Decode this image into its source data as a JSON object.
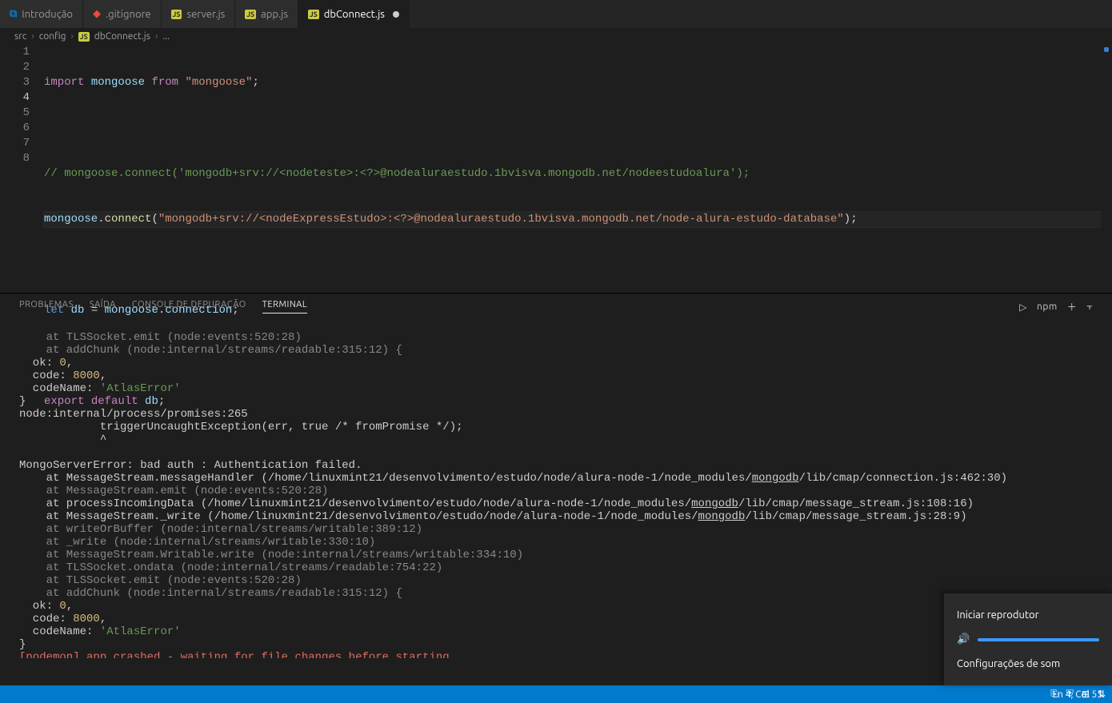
{
  "tabs": [
    {
      "icon": "vs",
      "label": "Introdução"
    },
    {
      "icon": "git",
      "label": ".gitignore"
    },
    {
      "icon": "js",
      "label": "server.js"
    },
    {
      "icon": "js",
      "label": "app.js"
    },
    {
      "icon": "js",
      "label": "dbConnect.js",
      "active": true,
      "modified": true
    }
  ],
  "breadcrumb": {
    "seg1": "src",
    "seg2": "config",
    "seg3": "dbConnect.js",
    "seg4": "..."
  },
  "code": {
    "lines": [
      "1",
      "2",
      "3",
      "4",
      "5",
      "6",
      "7",
      "8"
    ],
    "l1": {
      "import": "import",
      "mongoose": "mongoose",
      "from": "from",
      "str": "\"mongoose\"",
      "semi": ";"
    },
    "l3": {
      "comment": "// mongoose.connect('mongodb+srv://<nodeteste>:<?>@nodealuraestudo.1bvisva.mongodb.net/nodeestudoalura');"
    },
    "l4": {
      "obj": "mongoose",
      "dot": ".",
      "fn": "connect",
      "open": "(",
      "str": "\"mongodb+srv://<nodeExpressEstudo>:<?>@nodealuraestudo.1bvisva.mongodb.net/node-alura-estudo-database\"",
      "close": ")",
      "semi": ";"
    },
    "l6": {
      "let": "let",
      "db": "db",
      "eq": " = ",
      "mongoose": "mongoose",
      "dot": ".",
      "conn": "connection",
      "semi": ";"
    },
    "l8": {
      "export": "export",
      "default": "default",
      "db": "db",
      "semi": ";"
    }
  },
  "panel": {
    "tabs": {
      "problems": "PROBLEMAS",
      "output": "SAÍDA",
      "debug": "CONSOLE DE DEPURAÇÃO",
      "terminal": "TERMINAL"
    },
    "launcherLabel": "npm"
  },
  "terminal": {
    "l01": "    at TLSSocket.emit (node:events:520:28)",
    "l02": "    at addChunk (node:internal/streams/readable:315:12) {",
    "l03a": "  ok: ",
    "l03b": "0",
    "l03c": ",",
    "l04a": "  code: ",
    "l04b": "8000",
    "l04c": ",",
    "l05a": "  codeName: ",
    "l05b": "'AtlasError'",
    "l06": "}",
    "l07": "node:internal/process/promises:265",
    "l08": "            triggerUncaughtException(err, true /* fromPromise */);",
    "l09": "            ^",
    "l10": "",
    "l11": "MongoServerError: bad auth : Authentication failed.",
    "l12a": "    at MessageStream.messageHandler (/home/linuxmint21/desenvolvimento/estudo/node/alura-node-1/node_modules/",
    "l12b": "mongodb",
    "l12c": "/lib/cmap/connection.js:462:30)",
    "l13": "    at MessageStream.emit (node:events:520:28)",
    "l14a": "    at processIncomingData (/home/linuxmint21/desenvolvimento/estudo/node/alura-node-1/node_modules/",
    "l14b": "mongodb",
    "l14c": "/lib/cmap/message_stream.js:108:16)",
    "l15a": "    at MessageStream._write (/home/linuxmint21/desenvolvimento/estudo/node/alura-node-1/node_modules/",
    "l15b": "mongodb",
    "l15c": "/lib/cmap/message_stream.js:28:9)",
    "l16": "    at writeOrBuffer (node:internal/streams/writable:389:12)",
    "l17": "    at _write (node:internal/streams/writable:330:10)",
    "l18": "    at MessageStream.Writable.write (node:internal/streams/writable:334:10)",
    "l19": "    at TLSSocket.ondata (node:internal/streams/readable:754:22)",
    "l20": "    at TLSSocket.emit (node:events:520:28)",
    "l21": "    at addChunk (node:internal/streams/readable:315:12) {",
    "l22a": "  ok: ",
    "l22b": "0",
    "l22c": ",",
    "l23a": "  code: ",
    "l23b": "8000",
    "l23c": ",",
    "l24a": "  codeName: ",
    "l24b": "'AtlasError'",
    "l25": "}",
    "l26": "[nodemon] app crashed - waiting for file changes before starting...",
    "l27": "▯"
  },
  "status": {
    "position": "Ln 4, Col 55"
  },
  "popup": {
    "title": "Iniciar reprodutor",
    "settings": "Configurações de som"
  }
}
